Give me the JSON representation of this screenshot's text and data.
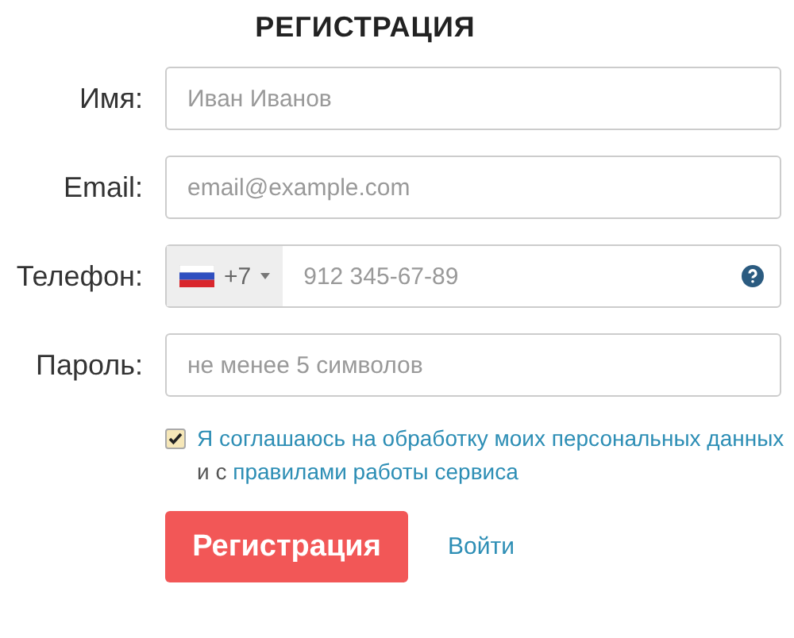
{
  "title": "РЕГИСТРАЦИЯ",
  "fields": [
    {
      "kind": "text",
      "label": "Имя:",
      "placeholder": "Иван Иванов"
    },
    {
      "kind": "text",
      "label": "Email:",
      "placeholder": "email@example.com"
    },
    {
      "kind": "phone",
      "label": "Телефон:",
      "code": "+7",
      "placeholder": "912 345-67-89"
    },
    {
      "kind": "text",
      "label": "Пароль:",
      "placeholder": "не менее 5 символов"
    }
  ],
  "consent": {
    "checked": true,
    "parts": [
      {
        "text": "Я соглашаюсь на обработку моих персональных данных",
        "link": true
      },
      {
        "text": "и с",
        "link": false
      },
      {
        "text": "правилами работы сервиса",
        "link": true
      }
    ]
  },
  "submit": "Регистрация",
  "login_link": "Войти"
}
